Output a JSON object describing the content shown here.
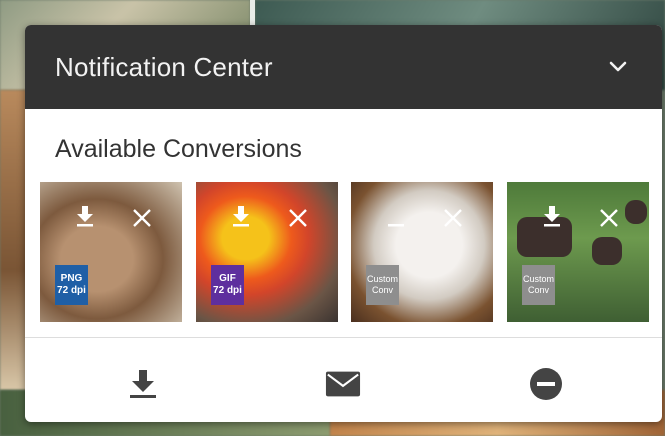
{
  "panel": {
    "title": "Notification Center",
    "section_title": "Available Conversions"
  },
  "conversions": [
    {
      "badge_line1": "PNG",
      "badge_line2": "72 dpi",
      "badge_color": "#1f5fa6",
      "image": "rodent"
    },
    {
      "badge_line1": "GIF",
      "badge_line2": "72 dpi",
      "badge_color": "#5e2f9e",
      "image": "parrot"
    },
    {
      "badge_line1": "Custom",
      "badge_line2": "Conv",
      "badge_color": "#8e8e8e",
      "image": "resting-animal"
    },
    {
      "badge_line1": "Custom",
      "badge_line2": "Conv",
      "badge_color": "#8e8e8e",
      "image": "moose-in-field"
    }
  ],
  "icons": {
    "header_toggle": "chevron-down-icon",
    "thumb_download": "download-icon",
    "thumb_remove": "close-icon",
    "footer": [
      "download-all-icon",
      "email-icon",
      "remove-all-icon"
    ]
  },
  "colors": {
    "header_bg": "#333333",
    "footer_icon": "#444444"
  }
}
